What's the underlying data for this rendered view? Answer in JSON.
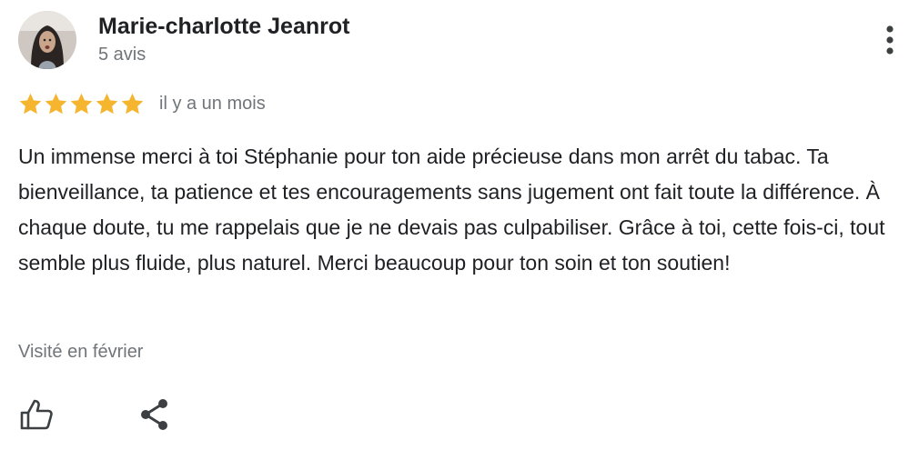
{
  "review": {
    "author": {
      "name": "Marie-charlotte Jeanrot",
      "review_count": "5 avis"
    },
    "rating": 5,
    "max_rating": 5,
    "date": "il y a un mois",
    "text": "Un immense merci à toi Stéphanie pour ton aide précieuse dans mon arrêt du tabac. Ta bienveillance, ta patience et tes encouragements sans jugement ont fait toute la différence. À chaque doute, tu me rappelais que je ne devais pas culpabiliser. Grâce à toi, cette fois-ci, tout semble plus fluide, plus naturel. Merci beaucoup pour ton soin et ton soutien!",
    "visited": "Visité en février"
  },
  "icons": {
    "more": "more-vert-icon",
    "star": "star-icon",
    "like": "thumb-up-icon",
    "share": "share-icon"
  },
  "colors": {
    "star": "#F5B52E",
    "text": "#202124",
    "secondary_text": "#70757A",
    "icon": "#3C4043"
  }
}
